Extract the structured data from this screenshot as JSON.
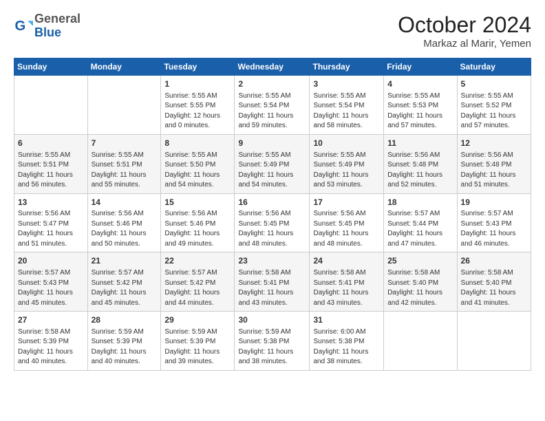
{
  "header": {
    "logo_general": "General",
    "logo_blue": "Blue",
    "month_title": "October 2024",
    "subtitle": "Markaz al Marir, Yemen"
  },
  "days_of_week": [
    "Sunday",
    "Monday",
    "Tuesday",
    "Wednesday",
    "Thursday",
    "Friday",
    "Saturday"
  ],
  "weeks": [
    [
      {
        "day": "",
        "info": ""
      },
      {
        "day": "",
        "info": ""
      },
      {
        "day": "1",
        "info": "Sunrise: 5:55 AM\nSunset: 5:55 PM\nDaylight: 12 hours\nand 0 minutes."
      },
      {
        "day": "2",
        "info": "Sunrise: 5:55 AM\nSunset: 5:54 PM\nDaylight: 11 hours\nand 59 minutes."
      },
      {
        "day": "3",
        "info": "Sunrise: 5:55 AM\nSunset: 5:54 PM\nDaylight: 11 hours\nand 58 minutes."
      },
      {
        "day": "4",
        "info": "Sunrise: 5:55 AM\nSunset: 5:53 PM\nDaylight: 11 hours\nand 57 minutes."
      },
      {
        "day": "5",
        "info": "Sunrise: 5:55 AM\nSunset: 5:52 PM\nDaylight: 11 hours\nand 57 minutes."
      }
    ],
    [
      {
        "day": "6",
        "info": "Sunrise: 5:55 AM\nSunset: 5:51 PM\nDaylight: 11 hours\nand 56 minutes."
      },
      {
        "day": "7",
        "info": "Sunrise: 5:55 AM\nSunset: 5:51 PM\nDaylight: 11 hours\nand 55 minutes."
      },
      {
        "day": "8",
        "info": "Sunrise: 5:55 AM\nSunset: 5:50 PM\nDaylight: 11 hours\nand 54 minutes."
      },
      {
        "day": "9",
        "info": "Sunrise: 5:55 AM\nSunset: 5:49 PM\nDaylight: 11 hours\nand 54 minutes."
      },
      {
        "day": "10",
        "info": "Sunrise: 5:55 AM\nSunset: 5:49 PM\nDaylight: 11 hours\nand 53 minutes."
      },
      {
        "day": "11",
        "info": "Sunrise: 5:56 AM\nSunset: 5:48 PM\nDaylight: 11 hours\nand 52 minutes."
      },
      {
        "day": "12",
        "info": "Sunrise: 5:56 AM\nSunset: 5:48 PM\nDaylight: 11 hours\nand 51 minutes."
      }
    ],
    [
      {
        "day": "13",
        "info": "Sunrise: 5:56 AM\nSunset: 5:47 PM\nDaylight: 11 hours\nand 51 minutes."
      },
      {
        "day": "14",
        "info": "Sunrise: 5:56 AM\nSunset: 5:46 PM\nDaylight: 11 hours\nand 50 minutes."
      },
      {
        "day": "15",
        "info": "Sunrise: 5:56 AM\nSunset: 5:46 PM\nDaylight: 11 hours\nand 49 minutes."
      },
      {
        "day": "16",
        "info": "Sunrise: 5:56 AM\nSunset: 5:45 PM\nDaylight: 11 hours\nand 48 minutes."
      },
      {
        "day": "17",
        "info": "Sunrise: 5:56 AM\nSunset: 5:45 PM\nDaylight: 11 hours\nand 48 minutes."
      },
      {
        "day": "18",
        "info": "Sunrise: 5:57 AM\nSunset: 5:44 PM\nDaylight: 11 hours\nand 47 minutes."
      },
      {
        "day": "19",
        "info": "Sunrise: 5:57 AM\nSunset: 5:43 PM\nDaylight: 11 hours\nand 46 minutes."
      }
    ],
    [
      {
        "day": "20",
        "info": "Sunrise: 5:57 AM\nSunset: 5:43 PM\nDaylight: 11 hours\nand 45 minutes."
      },
      {
        "day": "21",
        "info": "Sunrise: 5:57 AM\nSunset: 5:42 PM\nDaylight: 11 hours\nand 45 minutes."
      },
      {
        "day": "22",
        "info": "Sunrise: 5:57 AM\nSunset: 5:42 PM\nDaylight: 11 hours\nand 44 minutes."
      },
      {
        "day": "23",
        "info": "Sunrise: 5:58 AM\nSunset: 5:41 PM\nDaylight: 11 hours\nand 43 minutes."
      },
      {
        "day": "24",
        "info": "Sunrise: 5:58 AM\nSunset: 5:41 PM\nDaylight: 11 hours\nand 43 minutes."
      },
      {
        "day": "25",
        "info": "Sunrise: 5:58 AM\nSunset: 5:40 PM\nDaylight: 11 hours\nand 42 minutes."
      },
      {
        "day": "26",
        "info": "Sunrise: 5:58 AM\nSunset: 5:40 PM\nDaylight: 11 hours\nand 41 minutes."
      }
    ],
    [
      {
        "day": "27",
        "info": "Sunrise: 5:58 AM\nSunset: 5:39 PM\nDaylight: 11 hours\nand 40 minutes."
      },
      {
        "day": "28",
        "info": "Sunrise: 5:59 AM\nSunset: 5:39 PM\nDaylight: 11 hours\nand 40 minutes."
      },
      {
        "day": "29",
        "info": "Sunrise: 5:59 AM\nSunset: 5:39 PM\nDaylight: 11 hours\nand 39 minutes."
      },
      {
        "day": "30",
        "info": "Sunrise: 5:59 AM\nSunset: 5:38 PM\nDaylight: 11 hours\nand 38 minutes."
      },
      {
        "day": "31",
        "info": "Sunrise: 6:00 AM\nSunset: 5:38 PM\nDaylight: 11 hours\nand 38 minutes."
      },
      {
        "day": "",
        "info": ""
      },
      {
        "day": "",
        "info": ""
      }
    ]
  ]
}
